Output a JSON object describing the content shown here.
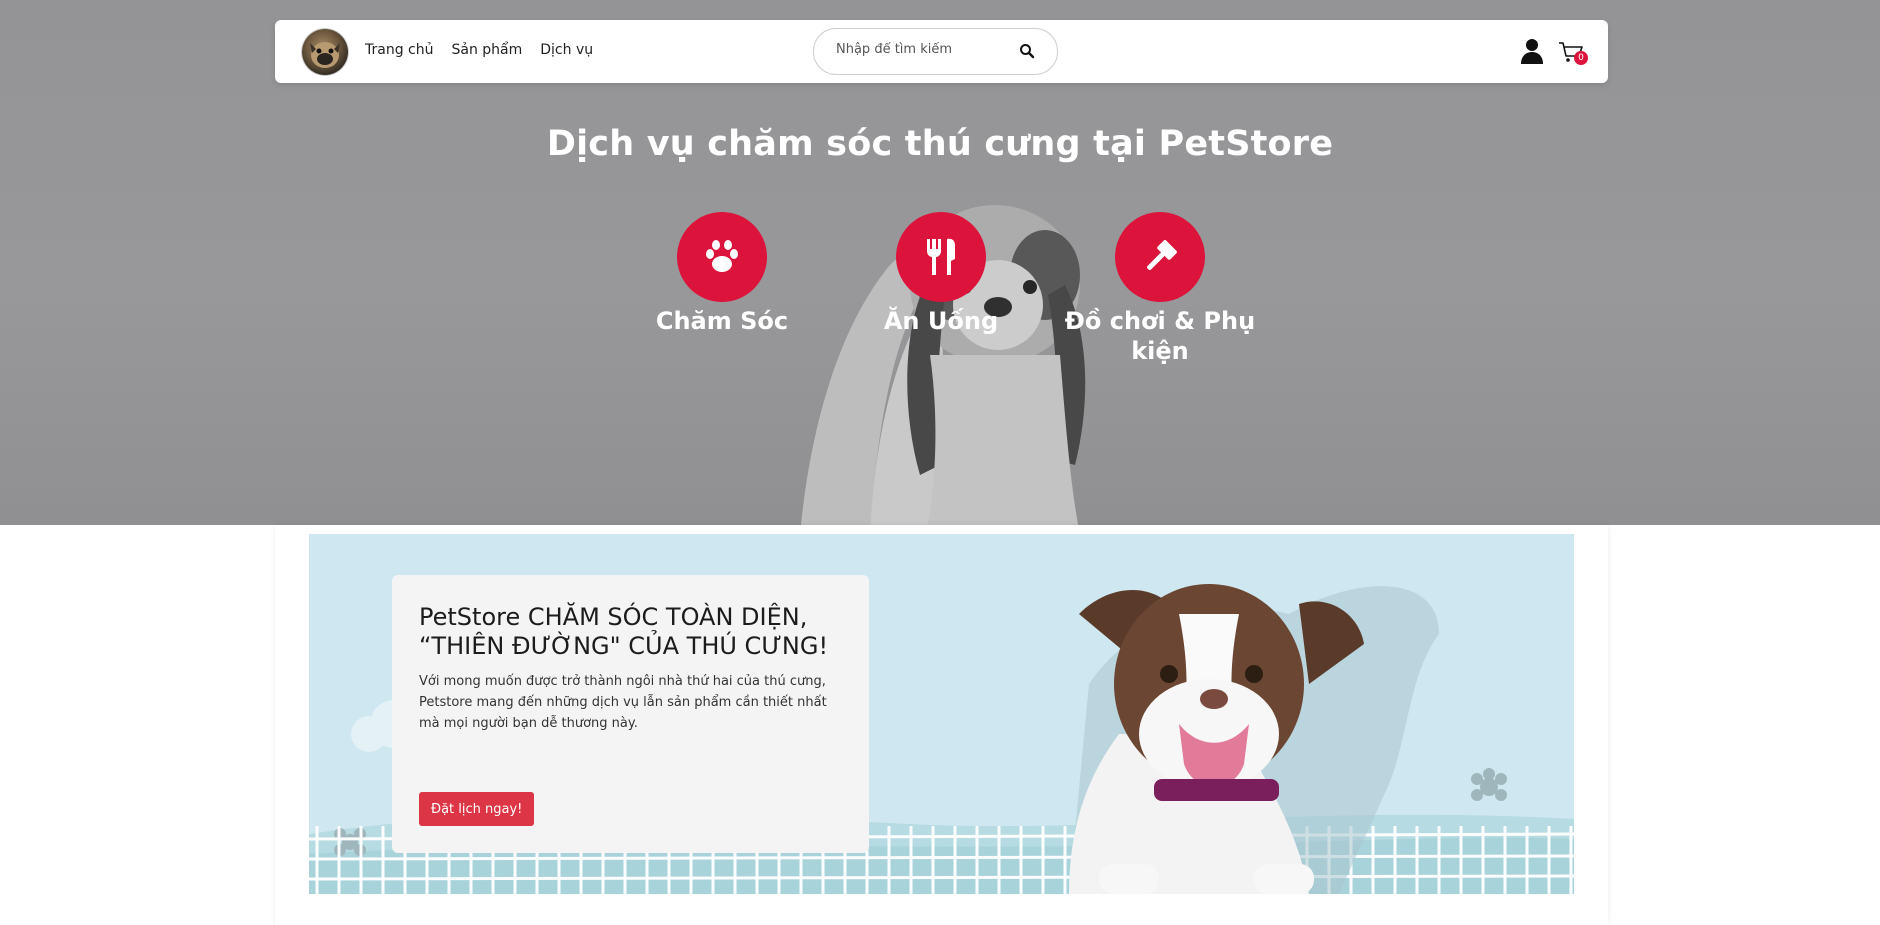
{
  "nav": {
    "links": [
      "Trang chủ",
      "Sản phẩm",
      "Dịch vụ"
    ],
    "search_placeholder": "Nhập để tìm kiếm",
    "cart_count": "0"
  },
  "hero": {
    "title": "Dịch vụ chăm sóc thú cưng tại PetStore",
    "services": [
      {
        "label": "Chăm Sóc",
        "icon": "paw-icon"
      },
      {
        "label": "Ăn Uống",
        "icon": "utensils-icon"
      },
      {
        "label": "Đồ chơi & Phụ kiện",
        "icon": "gavel-icon"
      }
    ]
  },
  "banner": {
    "title": "PetStore CHĂM SÓC TOÀN DIỆN, “THIÊN ĐƯỜNG\" CỦA THÚ CƯNG!",
    "description": "Với mong muốn được trở thành ngôi nhà thứ hai của thú cưng, Petstore mang đến những dịch vụ lẫn sản phẩm cần thiết nhất mà mọi người bạn dễ thương này.",
    "cta_label": "Đặt lịch ngay!"
  },
  "colors": {
    "accent": "#dc143c",
    "button": "#dc3545",
    "banner_bg": "#cfe7f0"
  }
}
